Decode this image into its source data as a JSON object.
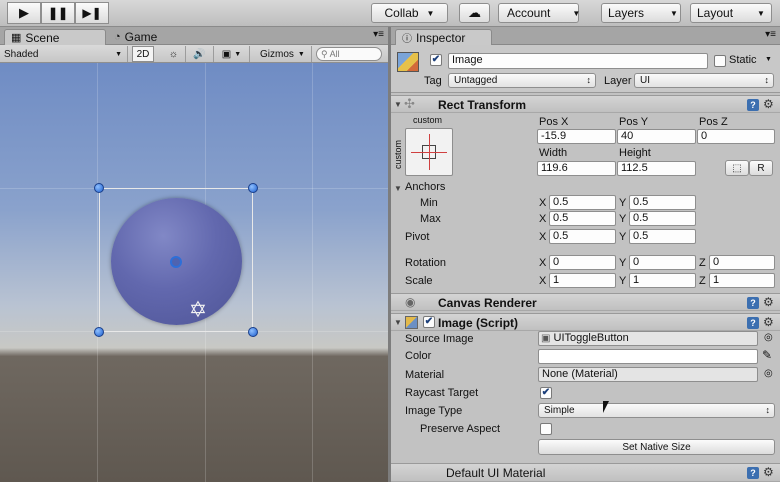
{
  "toolbar": {
    "collab_label": "Collab",
    "account_label": "Account",
    "layers_label": "Layers",
    "layout_label": "Layout"
  },
  "scene": {
    "tab_scene": "Scene",
    "tab_game": "Game",
    "shading": "Shaded",
    "mode_2d": "2D",
    "gizmos": "Gizmos",
    "search_placeholder": "All"
  },
  "inspector": {
    "tab_label": "Inspector",
    "object_name": "Image",
    "static_label": "Static",
    "tag_label": "Tag",
    "tag_value": "Untagged",
    "layer_label": "Layer",
    "layer_value": "UI"
  },
  "rect_transform": {
    "title": "Rect Transform",
    "anchor_preset": "custom",
    "anchor_side": "custom",
    "pos_x_label": "Pos X",
    "pos_y_label": "Pos Y",
    "pos_z_label": "Pos Z",
    "pos_x": "-15.9",
    "pos_y": "40",
    "pos_z": "0",
    "width_label": "Width",
    "height_label": "Height",
    "width": "119.6",
    "height": "112.5",
    "r_label": "R",
    "anchors_label": "Anchors",
    "min_label": "Min",
    "max_label": "Max",
    "pivot_label": "Pivot",
    "rotation_label": "Rotation",
    "scale_label": "Scale",
    "x": "X",
    "y": "Y",
    "z": "Z",
    "min_x": "0.5",
    "min_y": "0.5",
    "max_x": "0.5",
    "max_y": "0.5",
    "pivot_x": "0.5",
    "pivot_y": "0.5",
    "rot_x": "0",
    "rot_y": "0",
    "rot_z": "0",
    "scale_x": "1",
    "scale_y": "1",
    "scale_z": "1"
  },
  "canvas_renderer": {
    "title": "Canvas Renderer"
  },
  "image_script": {
    "title": "Image (Script)",
    "source_image_label": "Source Image",
    "source_image_value": "UIToggleButton",
    "color_label": "Color",
    "material_label": "Material",
    "material_value": "None (Material)",
    "raycast_label": "Raycast Target",
    "image_type_label": "Image Type",
    "image_type_value": "Simple",
    "preserve_label": "Preserve Aspect",
    "native_size_button": "Set Native Size"
  },
  "material_footer": {
    "title": "Default UI Material"
  },
  "colors": {
    "sphere": "#5c62a8",
    "accent": "#3c6fb0",
    "handle": "#2e6fd8"
  }
}
